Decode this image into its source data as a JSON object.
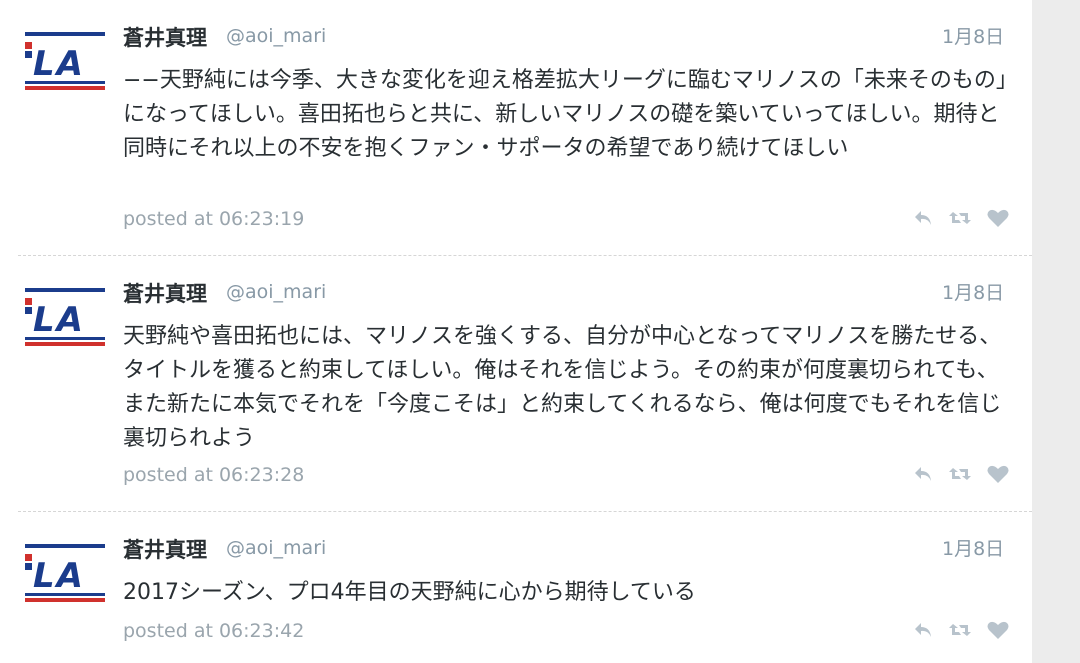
{
  "colors": {
    "name": "#292f33",
    "meta": "#8899a6",
    "icon": "#b8c3cc",
    "logo_blue": "#1b3c8c",
    "logo_red": "#d0312d"
  },
  "tweets": [
    {
      "name": "蒼井真理",
      "handle": "@aoi_mari",
      "date": "1月8日",
      "avatar_logo": "LA",
      "text": "−−天野純には今季、大きな変化を迎え格差拡大リーグに臨むマリノスの「未来そのもの」になってほしい。喜田拓也らと共に、新しいマリノスの礎を築いていってほしい。期待と同時にそれ以上の不安を抱くファン・サポータの希望であり続けてほしい",
      "posted": "posted at 06:23:19",
      "icons": [
        "reply-icon",
        "retweet-icon",
        "like-icon"
      ]
    },
    {
      "name": "蒼井真理",
      "handle": "@aoi_mari",
      "date": "1月8日",
      "avatar_logo": "LA",
      "text": "天野純や喜田拓也には、マリノスを強くする、自分が中心となってマリノスを勝たせる、タイトルを獲ると約束してほしい。俺はそれを信じよう。その約束が何度裏切られても、また新たに本気でそれを「今度こそは」と約束してくれるなら、俺は何度でもそれを信じ裏切られよう",
      "posted": "posted at 06:23:28",
      "icons": [
        "reply-icon",
        "retweet-icon",
        "like-icon"
      ]
    },
    {
      "name": "蒼井真理",
      "handle": "@aoi_mari",
      "date": "1月8日",
      "avatar_logo": "LA",
      "text": "2017シーズン、プロ4年目の天野純に心から期待している",
      "posted": "posted at 06:23:42",
      "icons": [
        "reply-icon",
        "retweet-icon",
        "like-icon"
      ]
    }
  ]
}
